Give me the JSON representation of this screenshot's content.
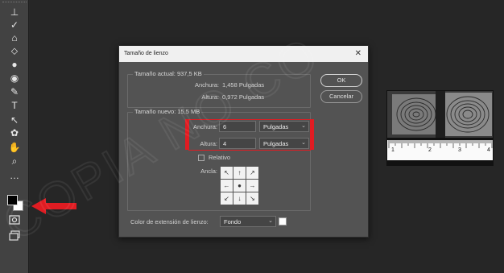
{
  "toolbar": {
    "tools": [
      {
        "icon": "clone-stamp-icon",
        "glyph": "⊥"
      },
      {
        "icon": "history-brush-icon",
        "glyph": "✓"
      },
      {
        "icon": "eraser-icon",
        "glyph": "⌂"
      },
      {
        "icon": "paint-bucket-icon",
        "glyph": "⬦"
      },
      {
        "icon": "blur-icon",
        "glyph": "●"
      },
      {
        "icon": "dodge-icon",
        "glyph": "◉"
      },
      {
        "icon": "pen-icon",
        "glyph": "✎"
      },
      {
        "icon": "type-icon",
        "glyph": "T"
      },
      {
        "icon": "path-selection-icon",
        "glyph": "↖"
      },
      {
        "icon": "custom-shape-icon",
        "glyph": "✿"
      },
      {
        "icon": "hand-icon",
        "glyph": "✋"
      },
      {
        "icon": "zoom-icon",
        "glyph": "⌕"
      },
      {
        "icon": "more-tools-icon",
        "glyph": "…"
      }
    ],
    "foreground_color": "#000000",
    "background_color": "#ffffff"
  },
  "dialog": {
    "title": "Tamaño de lienzo",
    "close_glyph": "✕",
    "current": {
      "legend": "Tamaño actual: 937,5 KB",
      "width_label": "Anchura:",
      "width_value": "1,458 Pulgadas",
      "height_label": "Altura:",
      "height_value": "0,972 Pulgadas"
    },
    "new": {
      "legend": "Tamaño nuevo: 15,5 MB",
      "width_label": "Anchura:",
      "width_value": "6",
      "width_unit": "Pulgadas",
      "height_label": "Altura:",
      "height_value": "4",
      "height_unit": "Pulgadas",
      "relative_label": "Relativo",
      "relative_checked": false,
      "anchor_label": "Ancla:",
      "anchor_cells": [
        "↖",
        "↑",
        "↗",
        "←",
        "●",
        "→",
        "↙",
        "↓",
        "↘"
      ]
    },
    "ok_label": "OK",
    "cancel_label": "Cancelar",
    "extension_label": "Color de extensión de lienzo:",
    "extension_value": "Fondo",
    "extension_color": "#ffffff",
    "caret": "⌄"
  },
  "photo": {
    "ruler_labels": [
      "1",
      "2",
      "3",
      "4"
    ]
  },
  "annotation_color": "#e01c22"
}
